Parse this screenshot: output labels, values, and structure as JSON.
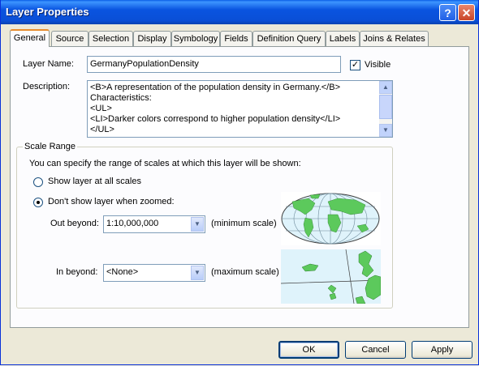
{
  "window": {
    "title": "Layer Properties",
    "help_glyph": "?",
    "close_glyph": "✕"
  },
  "tabs": [
    {
      "label": "General"
    },
    {
      "label": "Source"
    },
    {
      "label": "Selection"
    },
    {
      "label": "Display"
    },
    {
      "label": "Symbology"
    },
    {
      "label": "Fields"
    },
    {
      "label": "Definition Query"
    },
    {
      "label": "Labels"
    },
    {
      "label": "Joins & Relates"
    }
  ],
  "general": {
    "layer_name_label": "Layer Name:",
    "layer_name_value": "GermanyPopulationDensity",
    "visible_label": "Visible",
    "visible_checked": "✓",
    "description_label": "Description:",
    "description_lines": [
      "<B>A representation of the population density in Germany.</B>",
      "Characteristics:",
      "<UL>",
      "<LI>Darker colors correspond to higher population density</LI>",
      "</UL>"
    ]
  },
  "scale_range": {
    "title": "Scale Range",
    "intro": "You can specify the range of scales at which this layer will be shown:",
    "show_all_label": "Show layer at all scales",
    "dont_show_label": "Don't show layer when zoomed:",
    "out_beyond_label": "Out beyond:",
    "out_beyond_value": "1:10,000,000",
    "out_beyond_hint": "(minimum scale)",
    "in_beyond_label": "In beyond:",
    "in_beyond_value": "<None>",
    "in_beyond_hint": "(maximum scale)"
  },
  "buttons": {
    "ok": "OK",
    "cancel": "Cancel",
    "apply": "Apply"
  },
  "colors": {
    "accent": "#0a54e0",
    "land": "#5cc95c",
    "ocean": "#dff3fb"
  },
  "icons": {
    "dropdown": "▼",
    "scroll_up": "▲",
    "scroll_down": "▼"
  }
}
